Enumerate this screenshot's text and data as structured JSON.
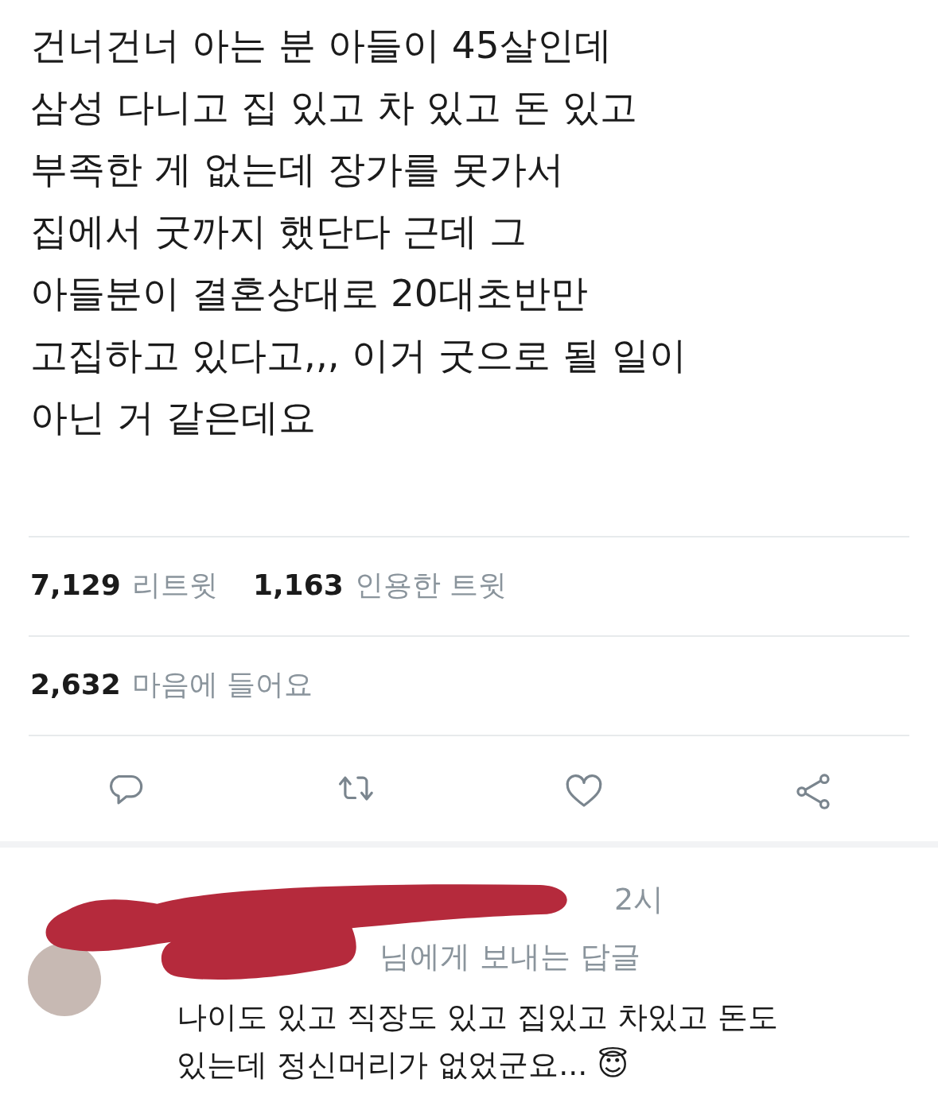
{
  "tweet": {
    "lines": [
      "건너건너 아는 분 아들이 45살인데",
      "삼성 다니고 집 있고 차 있고 돈 있고",
      "부족한 게 없는데 장가를 못가서",
      "집에서 굿까지 했단다 근데 그",
      "아들분이 결혼상대로 20대초반만",
      "고집하고 있다고,,, 이거 굿으로 될 일이",
      "아닌 거 같은데요"
    ],
    "stats": [
      [
        {
          "count": "7,129",
          "label": "리트윗"
        },
        {
          "count": "1,163",
          "label": "인용한 트윗"
        }
      ],
      [
        {
          "count": "2,632",
          "label": "마음에 들어요"
        }
      ]
    ],
    "actions": [
      {
        "kind": "reply"
      },
      {
        "kind": "retweet"
      },
      {
        "kind": "like"
      },
      {
        "kind": "share"
      }
    ]
  },
  "reply": {
    "time": "2시",
    "replying_to": "님에게 보내는 답글",
    "lines": [
      "나이도 있고 직장도 있고 집있고 차있고 돈도",
      "있는데 정신머리가 없었군요... 😇"
    ]
  }
}
